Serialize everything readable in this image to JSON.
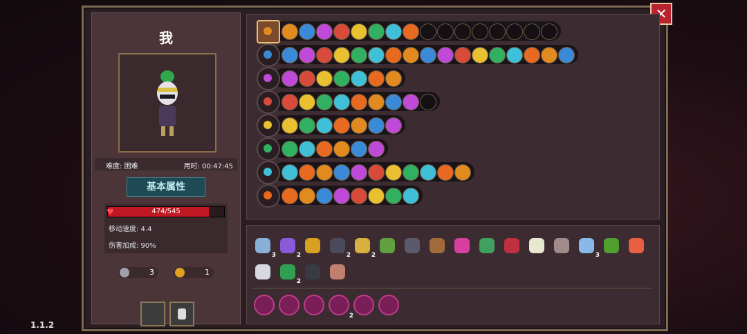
{
  "version": "1.1.2",
  "player": {
    "name": "我"
  },
  "info": {
    "difficulty_label": "难度: 困难",
    "time_label": "用时: 00:47:45"
  },
  "attributes_button": "基本属性",
  "stats": {
    "hp": "474/545",
    "hp_fraction": 0.87,
    "move_speed": "移动速度: 4.4",
    "damage_bonus": "伤害加成: 90%"
  },
  "resources": {
    "keys": "3",
    "coins": "1"
  },
  "colors": {
    "hp": "#c01822",
    "accent": "#e8c07a",
    "close": "#b8232f"
  },
  "close_icon": "close-x-icon",
  "weapon_rows": [
    {
      "icon": "treasure-bag-icon",
      "slots": 8,
      "empties": 8
    },
    {
      "icon": "staff-icon",
      "slots": 17,
      "empties": 0
    },
    {
      "icon": "scepter-icon",
      "slots": 7,
      "empties": 0
    },
    {
      "icon": "magic-wand-icon",
      "slots": 8,
      "empties": 1
    },
    {
      "icon": "flower-orb-icon",
      "slots": 7,
      "empties": 0
    },
    {
      "icon": "sun-orb-icon",
      "slots": 6,
      "empties": 0
    },
    {
      "icon": "dark-staff-icon",
      "slots": 11,
      "empties": 0
    },
    {
      "icon": "purple-orb-icon",
      "slots": 8,
      "empties": 0
    }
  ],
  "items": [
    {
      "icon": "ghost-shield-icon",
      "count": "3"
    },
    {
      "icon": "wizard-hat-icon",
      "count": "2"
    },
    {
      "icon": "gauntlet-icon",
      "count": ""
    },
    {
      "icon": "dark-cloak-icon",
      "count": "2"
    },
    {
      "icon": "antler-icon",
      "count": "2"
    },
    {
      "icon": "map-scroll-icon",
      "count": ""
    },
    {
      "icon": "dark-robe-icon",
      "count": ""
    },
    {
      "icon": "amulet-icon",
      "count": ""
    },
    {
      "icon": "pink-flame-icon",
      "count": ""
    },
    {
      "icon": "leaf-icon",
      "count": ""
    },
    {
      "icon": "demon-mask-icon",
      "count": ""
    },
    {
      "icon": "fangs-icon",
      "count": ""
    },
    {
      "icon": "skull-orb-icon",
      "count": ""
    },
    {
      "icon": "ice-wings-icon",
      "count": "3"
    },
    {
      "icon": "green-fruit-icon",
      "count": ""
    },
    {
      "icon": "heart-icon",
      "count": ""
    },
    {
      "icon": "white-crown-icon",
      "count": ""
    },
    {
      "icon": "clover-icon",
      "count": "2"
    },
    {
      "icon": "black-crow-icon",
      "count": ""
    },
    {
      "icon": "skin-pouch-icon",
      "count": ""
    }
  ],
  "curses": [
    {
      "icon": "curse-spiral-icon",
      "count": ""
    },
    {
      "icon": "curse-chest-icon",
      "count": ""
    },
    {
      "icon": "curse-eye-icon",
      "count": ""
    },
    {
      "icon": "curse-swirl-icon",
      "count": "2"
    },
    {
      "icon": "curse-mask-icon",
      "count": ""
    },
    {
      "icon": "curse-rune-icon",
      "count": ""
    }
  ]
}
